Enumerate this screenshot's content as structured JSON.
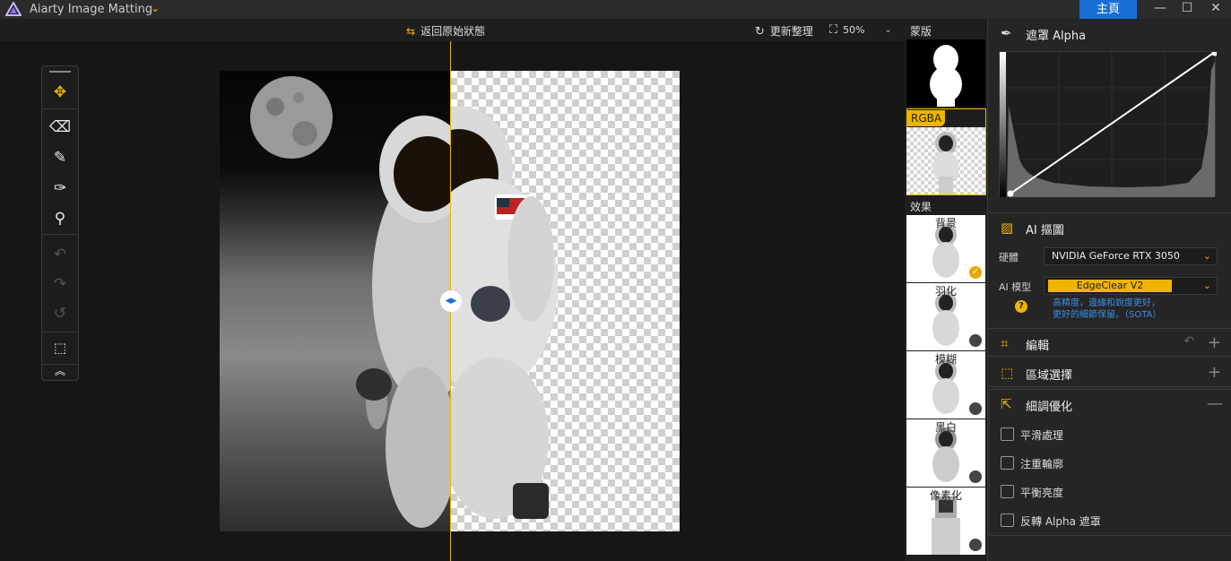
{
  "app": {
    "title": "Aiarty Image Matting",
    "home_label": "主頁",
    "window_controls": [
      "minimize",
      "maximize",
      "close"
    ]
  },
  "toolbar": {
    "restore_label": "返回原始狀態",
    "reorganize_label": "更新整理",
    "zoom_value": "50%"
  },
  "tools": [
    "move-tool",
    "eraser-tool",
    "brush-tool",
    "sweep-tool",
    "roller-tool",
    "undo",
    "redo",
    "reset",
    "selection",
    "collapse"
  ],
  "thumbnails": {
    "mask_label": "蒙版",
    "rgba_label": "RGBA",
    "effects_label": "效果",
    "effects": [
      {
        "label": "背景",
        "selected": true
      },
      {
        "label": "羽化",
        "selected": false
      },
      {
        "label": "模糊",
        "selected": false
      },
      {
        "label": "黑白",
        "selected": false
      },
      {
        "label": "像素化",
        "selected": false
      }
    ]
  },
  "panel": {
    "alpha_title": "遮罩 Alpha",
    "ai_title": "AI 摳圖",
    "hardware_label": "硬體",
    "hardware_value": "NVIDIA GeForce RTX 3050",
    "model_label": "AI 模型",
    "model_value": "EdgeClear  V2",
    "model_desc_1": "高精度，邊緣和銳度更好，",
    "model_desc_2": "更好的細節保留。（SOTA）",
    "edit_title": "編輯",
    "region_title": "區域選擇",
    "refine_title": "細調優化",
    "options": [
      {
        "label": "平滑處理",
        "checked": false
      },
      {
        "label": "注重輪廓",
        "checked": false
      },
      {
        "label": "平衡亮度",
        "checked": false
      },
      {
        "label": "反轉 Alpha 遮罩",
        "checked": false
      }
    ]
  },
  "colors": {
    "accent": "#f0b400",
    "blue": "#1a6fd6"
  }
}
